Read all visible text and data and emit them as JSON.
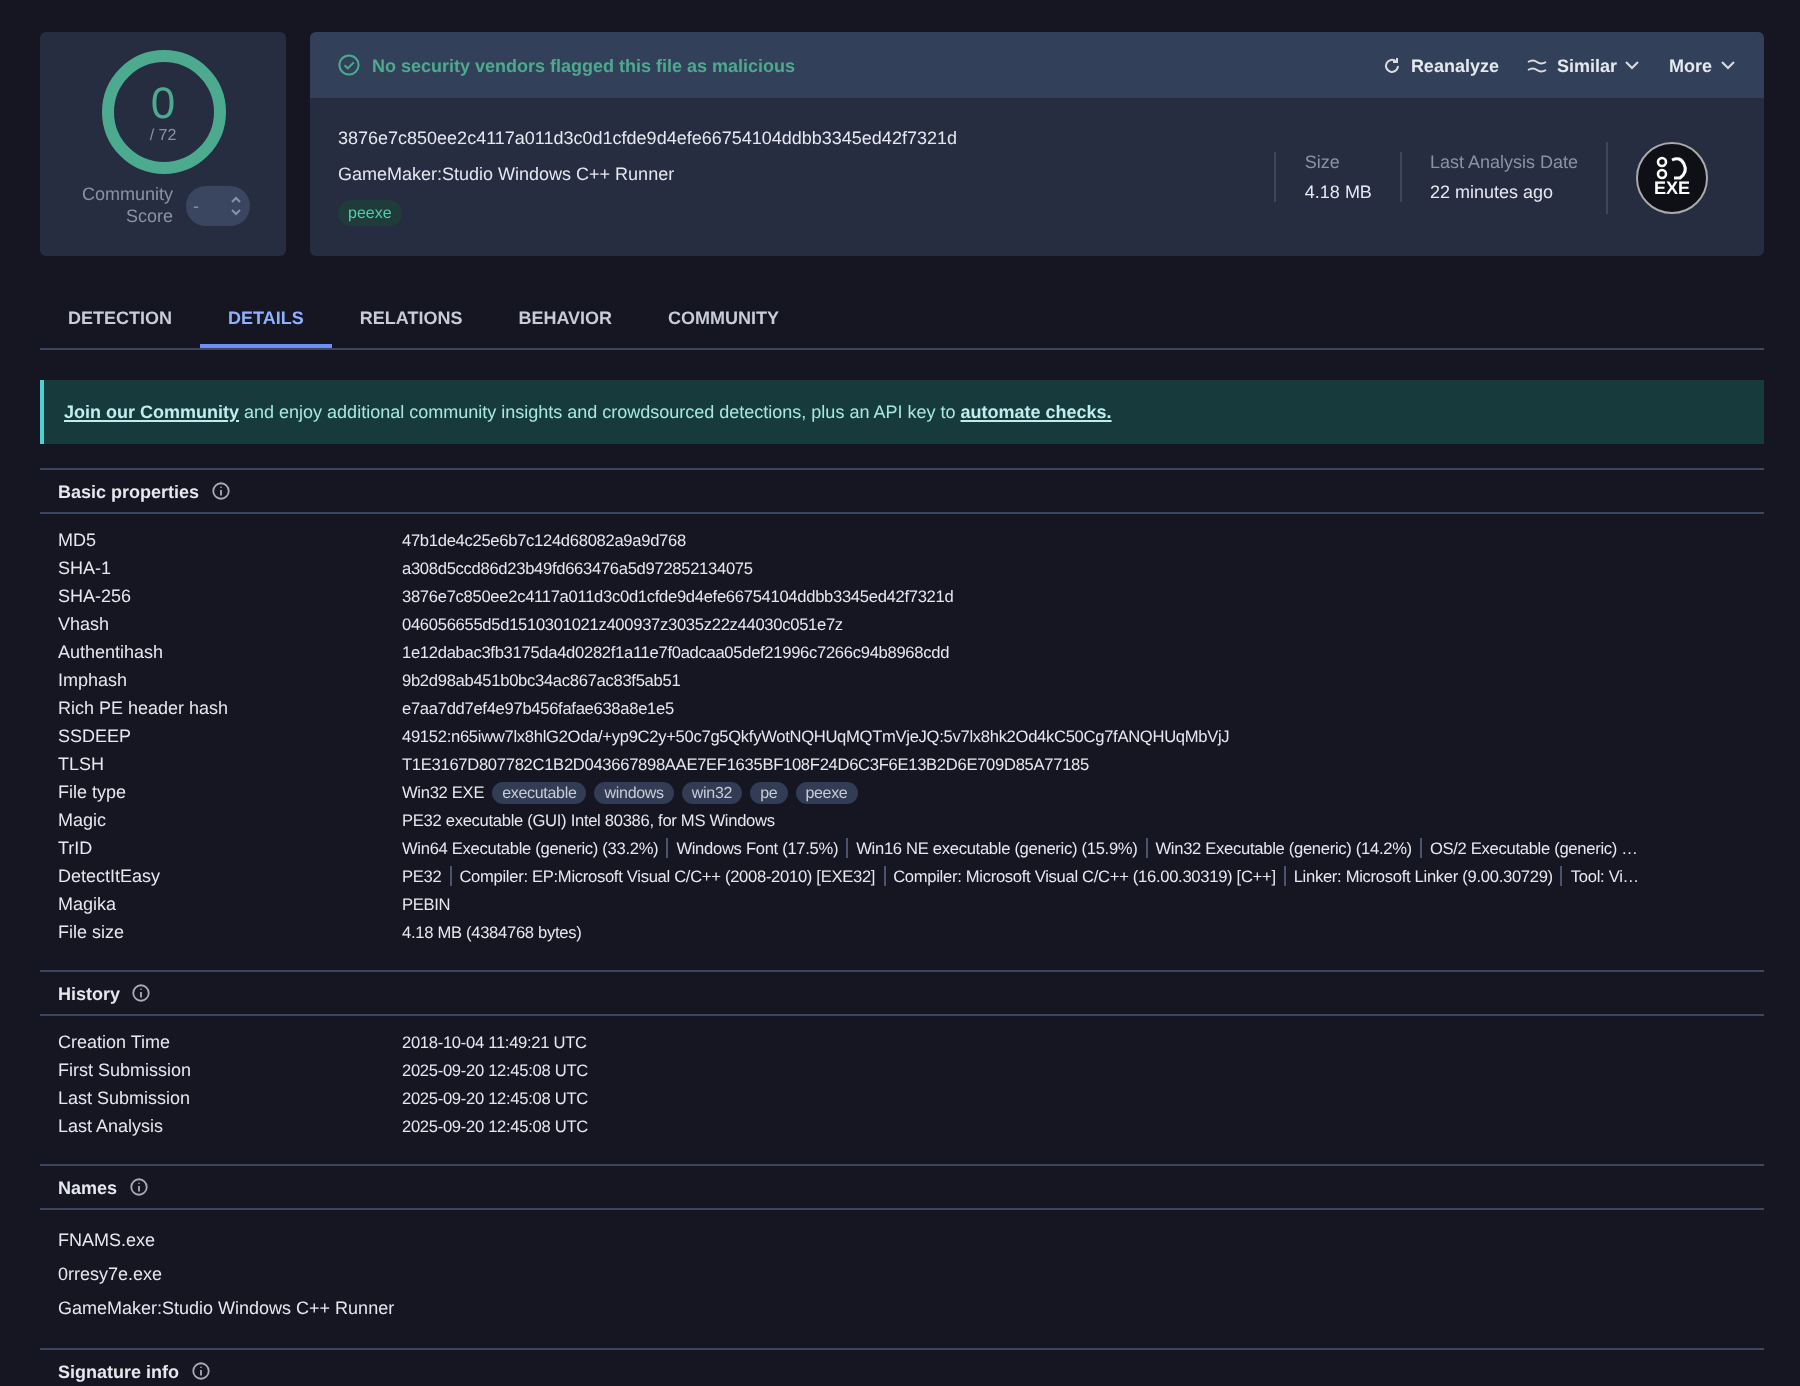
{
  "score": {
    "value": "0",
    "total": "/ 72",
    "community_label": "Community Score",
    "community_value": "-"
  },
  "header": {
    "verdict": "No security vendors flagged this file as malicious",
    "actions": [
      {
        "label": "Reanalyze",
        "caret": false
      },
      {
        "label": "Similar",
        "caret": true
      },
      {
        "label": "More",
        "caret": true
      }
    ],
    "hash": "3876e7c850ee2c4117a011d3c0d1cfde9d4efe66754104ddbb3345ed42f7321d",
    "name": "GameMaker:Studio Windows C++ Runner",
    "tags": [
      "peexe"
    ],
    "stats": [
      {
        "label": "Size",
        "value": "4.18 MB"
      },
      {
        "label": "Last Analysis Date",
        "value": "22 minutes ago"
      }
    ],
    "file_type_badge": "EXE"
  },
  "tabs": [
    {
      "label": "DETECTION",
      "selected": false
    },
    {
      "label": "DETAILS",
      "selected": true
    },
    {
      "label": "RELATIONS",
      "selected": false
    },
    {
      "label": "BEHAVIOR",
      "selected": false
    },
    {
      "label": "COMMUNITY",
      "selected": false
    }
  ],
  "banner": {
    "link1": "Join our Community",
    "text": "and enjoy additional community insights and crowdsourced detections, plus an API key to",
    "link2": "automate checks."
  },
  "basic_properties": {
    "title": "Basic properties",
    "rows": [
      {
        "kind": "text",
        "label": "MD5",
        "value": "47b1de4c25e6b7c124d68082a9a9d768"
      },
      {
        "kind": "text",
        "label": "SHA-1",
        "value": "a308d5ccd86d23b49fd663476a5d972852134075"
      },
      {
        "kind": "text",
        "label": "SHA-256",
        "value": "3876e7c850ee2c4117a011d3c0d1cfde9d4efe66754104ddbb3345ed42f7321d"
      },
      {
        "kind": "text",
        "label": "Vhash",
        "value": "046056655d5d1510301021z400937z3035z22z44030c051e7z"
      },
      {
        "kind": "text",
        "label": "Authentihash",
        "value": "1e12dabac3fb3175da4d0282f1a11e7f0adcaa05def21996c7266c94b8968cdd"
      },
      {
        "kind": "text",
        "label": "Imphash",
        "value": "9b2d98ab451b0bc34ac867ac83f5ab51"
      },
      {
        "kind": "text",
        "label": "Rich PE header hash",
        "value": "e7aa7dd7ef4e97b456fafae638a8e1e5"
      },
      {
        "kind": "text",
        "label": "SSDEEP",
        "value": "49152:n65iww7lx8hlG2Oda/+yp9C2y+50c7g5QkfyWotNQHUqMQTmVjeJQ:5v7lx8hk2Od4kC50Cg7fANQHUqMbVjJ"
      },
      {
        "kind": "text",
        "label": "TLSH",
        "value": "T1E3167D807782C1B2D043667898AAE7EF1635BF108F24D6C3F6E13B2D6E709D85A77185"
      },
      {
        "kind": "tags",
        "label": "File type",
        "value": "Win32 EXE",
        "tags": [
          "executable",
          "windows",
          "win32",
          "pe",
          "peexe"
        ]
      },
      {
        "kind": "text",
        "label": "Magic",
        "value": "PE32 executable (GUI) Intel 80386, for MS Windows"
      },
      {
        "kind": "parts",
        "label": "TrID",
        "parts": [
          "Win64 Executable (generic) (33.2%)",
          "Windows Font (17.5%)",
          "Win16 NE executable (generic) (15.9%)",
          "Win32 Executable (generic) (14.2%)",
          "OS/2 Executable (generic) …"
        ]
      },
      {
        "kind": "parts",
        "label": "DetectItEasy",
        "parts": [
          "PE32",
          "Compiler: EP:Microsoft Visual C/C++ (2008-2010) [EXE32]",
          "Compiler: Microsoft Visual C/C++ (16.00.30319) [C++]",
          "Linker: Microsoft Linker (9.00.30729)",
          "Tool: Vi…"
        ]
      },
      {
        "kind": "text",
        "label": "Magika",
        "value": "PEBIN"
      },
      {
        "kind": "text",
        "label": "File size",
        "value": "4.18 MB (4384768 bytes)"
      }
    ]
  },
  "history": {
    "title": "History",
    "rows": [
      {
        "label": "Creation Time",
        "value": "2018-10-04 11:49:21 UTC"
      },
      {
        "label": "First Submission",
        "value": "2025-09-20 12:45:08 UTC"
      },
      {
        "label": "Last Submission",
        "value": "2025-09-20 12:45:08 UTC"
      },
      {
        "label": "Last Analysis",
        "value": "2025-09-20 12:45:08 UTC"
      }
    ]
  },
  "names": {
    "title": "Names",
    "items": [
      "FNAMS.exe",
      "0rresy7e.exe",
      "GameMaker:Studio Windows C++ Runner"
    ]
  },
  "signature": {
    "title": "Signature info"
  }
}
